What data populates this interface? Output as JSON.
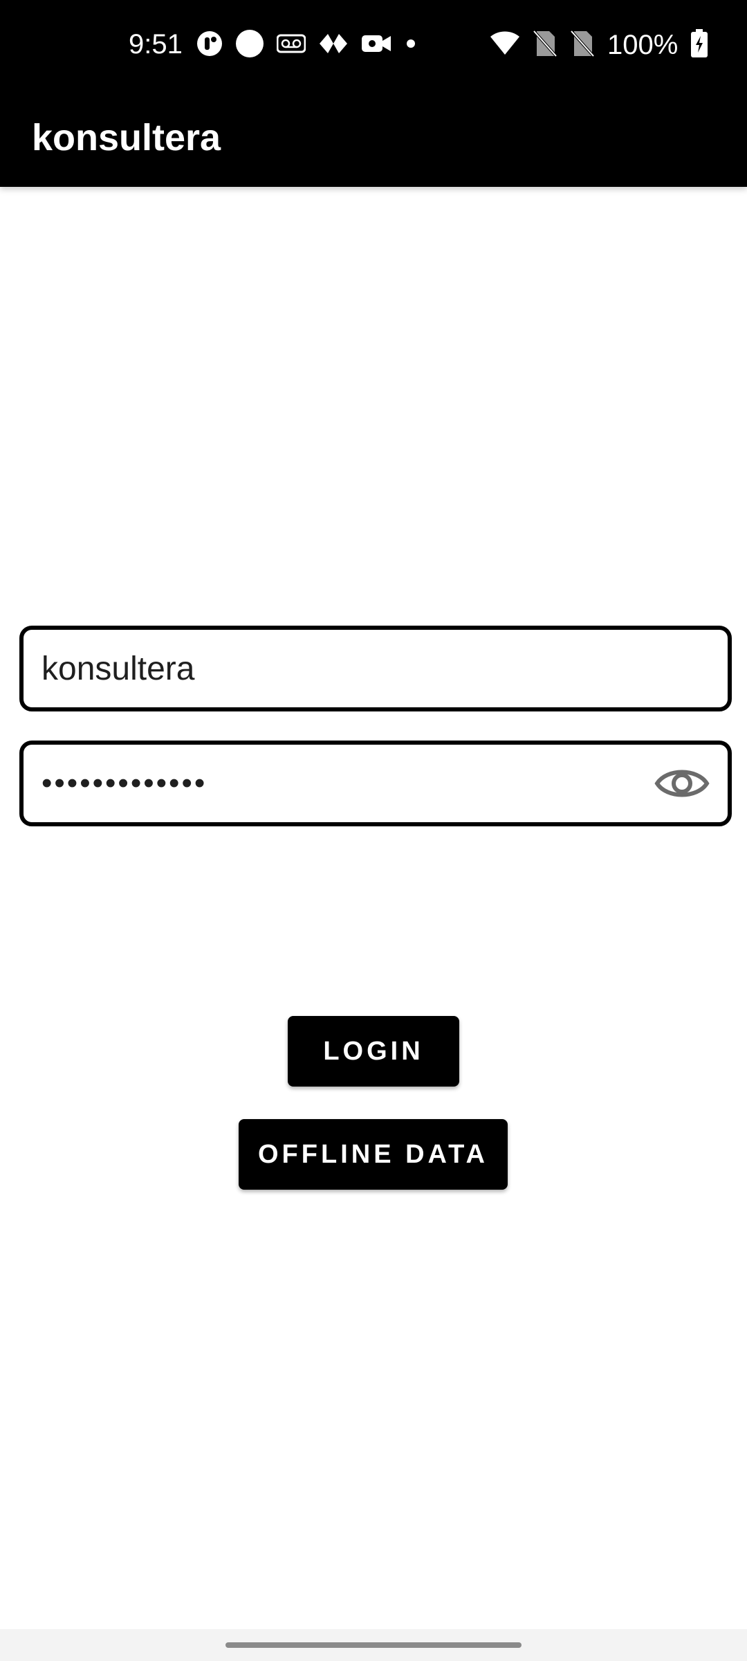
{
  "status_bar": {
    "time": "9:51",
    "battery_percent": "100%",
    "left_icons": [
      "threads-icon",
      "circle-icon",
      "voicemail-icon",
      "navigation-icon",
      "video-camera-icon",
      "dot-icon"
    ],
    "right_icons": [
      "wifi-icon",
      "no-sim-icon",
      "no-sim-icon",
      "battery-charging-icon"
    ]
  },
  "app_bar": {
    "title": "konsultera"
  },
  "login_form": {
    "username_value": "konsultera",
    "password_masked": "•••••••••••••",
    "show_password_icon": "eye-icon"
  },
  "buttons": {
    "login_label": "LOGIN",
    "offline_label": "OFFLINE DATA"
  },
  "colors": {
    "app_bar_bg": "#000000",
    "button_bg": "#000000",
    "button_text": "#ffffff",
    "page_bg": "#ffffff"
  }
}
